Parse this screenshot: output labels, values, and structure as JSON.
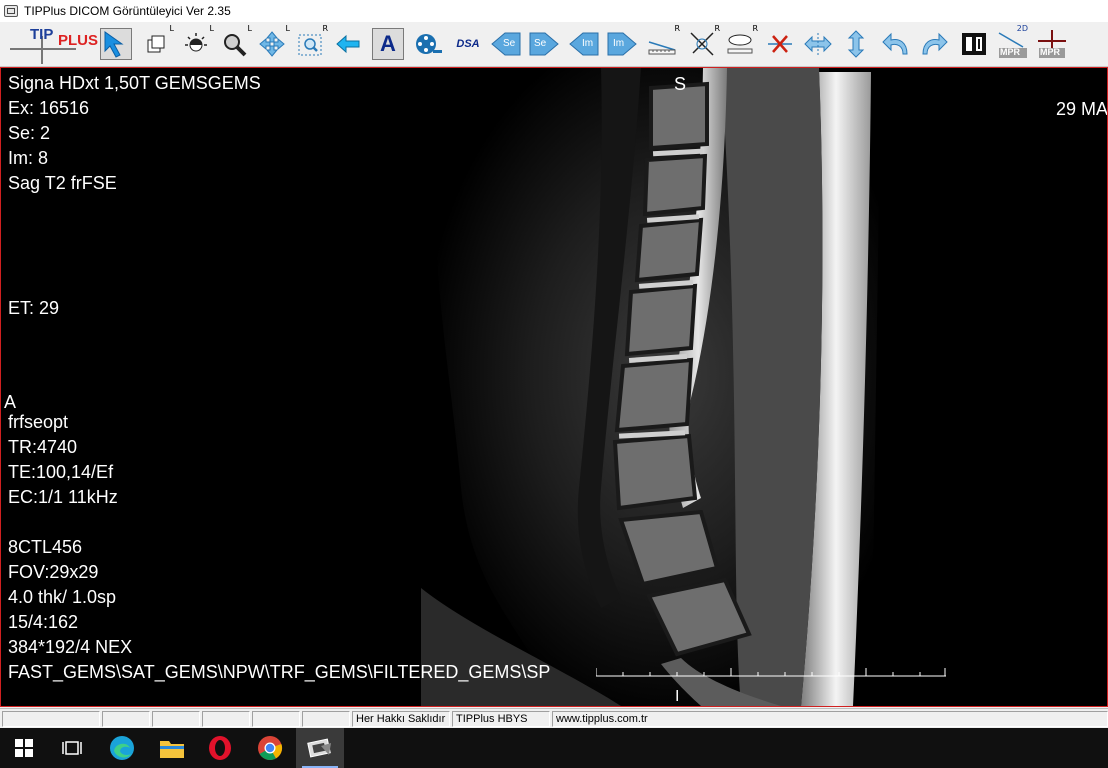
{
  "window": {
    "title": "TIPPlus DICOM Görüntüleyici Ver 2.35"
  },
  "toolbar": {
    "logo": {
      "part1": "TIP",
      "part2": "PLUS"
    },
    "tools": [
      {
        "icon": "select-arrow-icon",
        "active": true
      },
      {
        "icon": "layers-icon",
        "superscript": "L"
      },
      {
        "icon": "brightness-contrast-icon",
        "superscript": "L"
      },
      {
        "icon": "magnifier-icon",
        "superscript": "L"
      },
      {
        "icon": "pan-move-icon",
        "superscript": "L"
      },
      {
        "icon": "zoom-region-icon",
        "superscript": "R"
      },
      {
        "icon": "back-arrow-icon"
      },
      {
        "icon": "annotation-text-icon",
        "text": "A",
        "active": true
      },
      {
        "icon": "film-reel-icon"
      },
      {
        "icon": "dsa-icon",
        "text": "DSA"
      },
      {
        "icon": "previous-series-icon",
        "text": "Se"
      },
      {
        "icon": "next-series-icon",
        "text": "Se"
      },
      {
        "icon": "previous-image-icon",
        "text": "Im"
      },
      {
        "icon": "next-image-icon",
        "text": "Im"
      },
      {
        "icon": "ruler-icon",
        "superscript": "R"
      },
      {
        "icon": "angle-measure-icon",
        "superscript": "R"
      },
      {
        "icon": "ellipse-roi-icon",
        "superscript": "R"
      },
      {
        "icon": "delete-measurement-icon"
      },
      {
        "icon": "flip-horizontal-icon"
      },
      {
        "icon": "flip-vertical-icon"
      },
      {
        "icon": "rotate-left-icon"
      },
      {
        "icon": "rotate-right-icon"
      },
      {
        "icon": "layout-panes-icon"
      },
      {
        "icon": "mpr-2d-icon",
        "text": "MPR",
        "superscript": "2D"
      },
      {
        "icon": "crosshair-mpr-icon",
        "text": "MPR"
      }
    ]
  },
  "overlay": {
    "top_left": [
      "Signa HDxt 1,50T GEMSGEMS",
      "Ex: 16516",
      "Se: 2",
      "Im: 8",
      "Sag T2 frFSE"
    ],
    "et": "ET: 29",
    "orientation_top": "S",
    "orientation_left": "A",
    "date_partial": "29 MA",
    "params_1": [
      "frfseopt",
      "TR:4740",
      "TE:100,14/Ef",
      "EC:1/1 11kHz"
    ],
    "params_2": [
      "8CTL456",
      "FOV:29x29",
      "4.0 thk/ 1.0sp",
      "15/4:162",
      "384*192/4 NEX",
      "FAST_GEMS\\SAT_GEMS\\NPW\\TRF_GEMS\\FILTERED_GEMS\\SP"
    ],
    "cursor": "I"
  },
  "statusbar": {
    "cells": [
      "",
      "",
      "",
      "",
      "",
      "",
      "Her Hakkı Saklıdır",
      "TIPPlus HBYS",
      "www.tipplus.com.tr"
    ]
  },
  "taskbar": {
    "items": [
      {
        "icon": "windows-start-icon"
      },
      {
        "icon": "task-view-icon"
      },
      {
        "icon": "edge-browser-icon"
      },
      {
        "icon": "file-explorer-icon"
      },
      {
        "icon": "opera-browser-icon"
      },
      {
        "icon": "chrome-browser-icon"
      },
      {
        "icon": "dicom-viewer-app-icon",
        "active": true
      }
    ]
  }
}
